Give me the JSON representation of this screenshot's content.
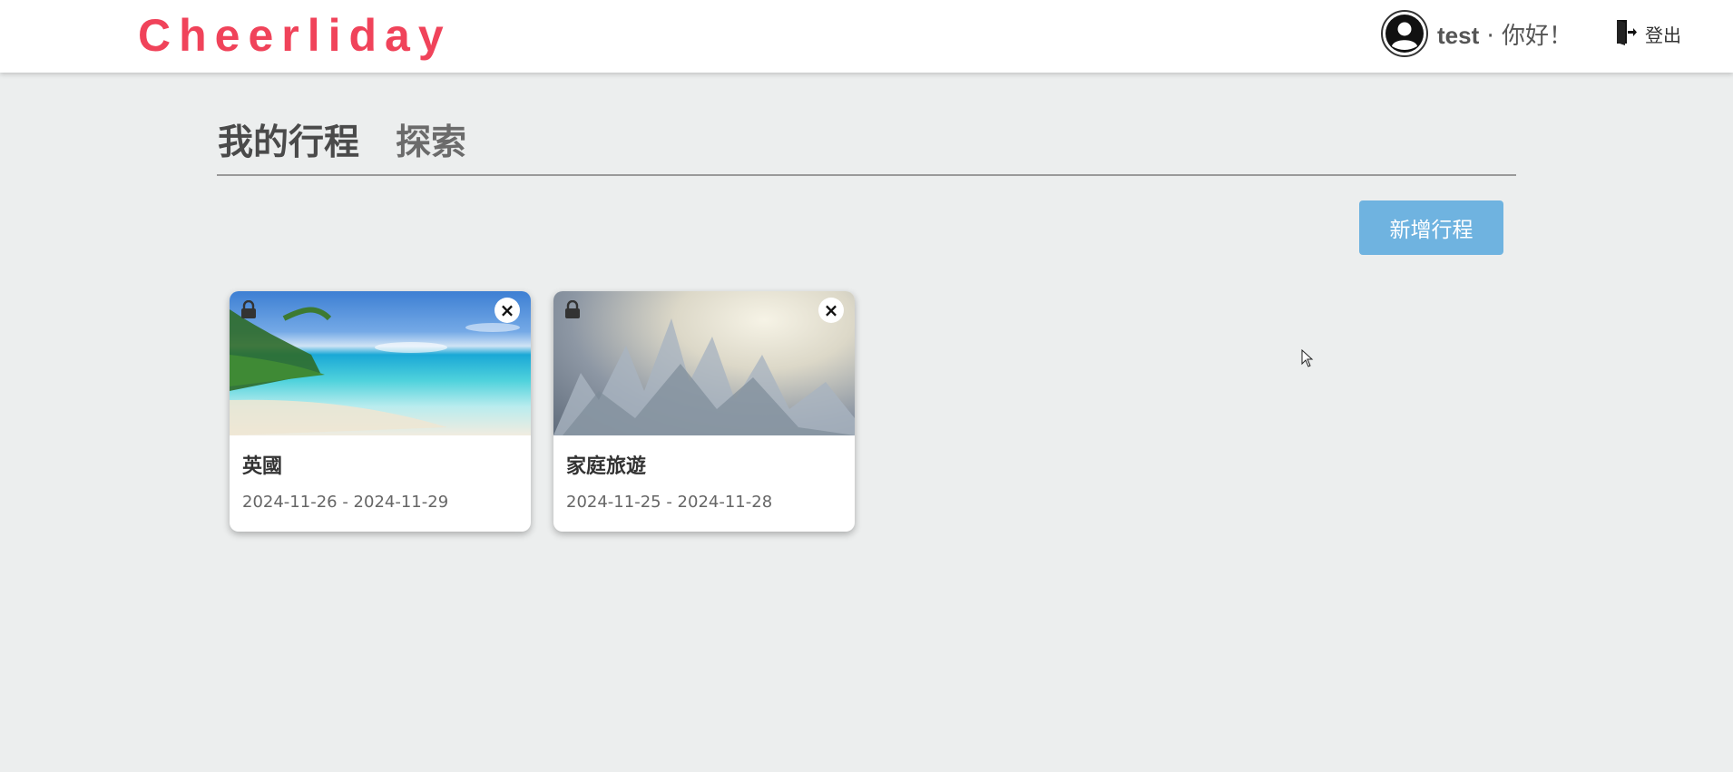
{
  "header": {
    "logo": "Cheerliday",
    "username": "test",
    "greeting": "· 你好！",
    "logout_label": "登出"
  },
  "tabs": [
    {
      "label": "我的行程",
      "active": true
    },
    {
      "label": "探索",
      "active": false
    }
  ],
  "actions": {
    "add_trip_label": "新增行程"
  },
  "trips": [
    {
      "title": "英國",
      "dates": "2024-11-26 - 2024-11-29",
      "image": "beach",
      "private": true
    },
    {
      "title": "家庭旅遊",
      "dates": "2024-11-25 - 2024-11-28",
      "image": "frost",
      "private": true
    }
  ],
  "colors": {
    "brand": "#f0435a",
    "button": "#6fb3e0",
    "background": "#eceeee"
  },
  "icons": {
    "avatar": "user-avatar-icon",
    "logout": "door-exit-icon",
    "lock": "lock-icon",
    "close": "close-icon"
  }
}
